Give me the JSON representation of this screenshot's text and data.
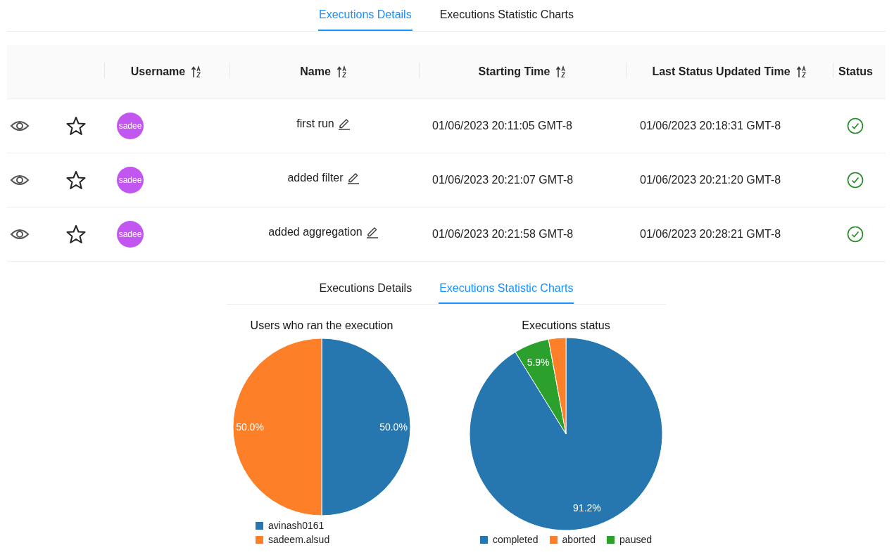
{
  "top_tabs": [
    {
      "label": "Executions Details",
      "selected": true
    },
    {
      "label": "Executions Statistic Charts",
      "selected": false
    }
  ],
  "table": {
    "columns": [
      {
        "label": "Username",
        "sortable": true
      },
      {
        "label": "Name",
        "sortable": true
      },
      {
        "label": "Starting Time",
        "sortable": true
      },
      {
        "label": "Last Status Updated Time",
        "sortable": true
      },
      {
        "label": "Status",
        "sortable": false
      }
    ],
    "rows": [
      {
        "starred": false,
        "avatar": "sadee",
        "name": "first run",
        "starting_time": "01/06/2023 20:11:05 GMT-8",
        "last_status_updated_time": "01/06/2023 20:18:31 GMT-8"
      },
      {
        "starred": false,
        "avatar": "sadee",
        "name": "added filter",
        "starting_time": "01/06/2023 20:21:07 GMT-8",
        "last_status_updated_time": "01/06/2023 20:21:20 GMT-8"
      },
      {
        "starred": false,
        "avatar": "sadee",
        "name": "added aggregation",
        "starting_time": "01/06/2023 20:21:58 GMT-8",
        "last_status_updated_time": "01/06/2023 20:28:21 GMT-8"
      }
    ]
  },
  "bottom_tabs": [
    {
      "label": "Executions Details",
      "selected": false
    },
    {
      "label": "Executions Statistic Charts",
      "selected": true
    }
  ],
  "charts": [
    {
      "chart_data": {
        "type": "pie",
        "title": "Users who ran the execution",
        "categories": [
          "avinash0161",
          "sadeem.alsud"
        ],
        "colors": [
          "#2677b0",
          "#fd7f28"
        ],
        "values": [
          50,
          50
        ],
        "value_labels": [
          "50.0%",
          "50.0%"
        ],
        "legend": true
      }
    },
    {
      "chart_data": {
        "type": "pie",
        "title": "Executions status",
        "categories": [
          "completed",
          "aborted",
          "paused"
        ],
        "colors": [
          "#2677b0",
          "#fd7f28",
          "#2ca02c"
        ],
        "values": [
          91.2,
          2.9,
          5.9
        ],
        "value_labels": [
          "91.2%",
          null,
          "5.9%"
        ],
        "legend": true
      }
    }
  ]
}
